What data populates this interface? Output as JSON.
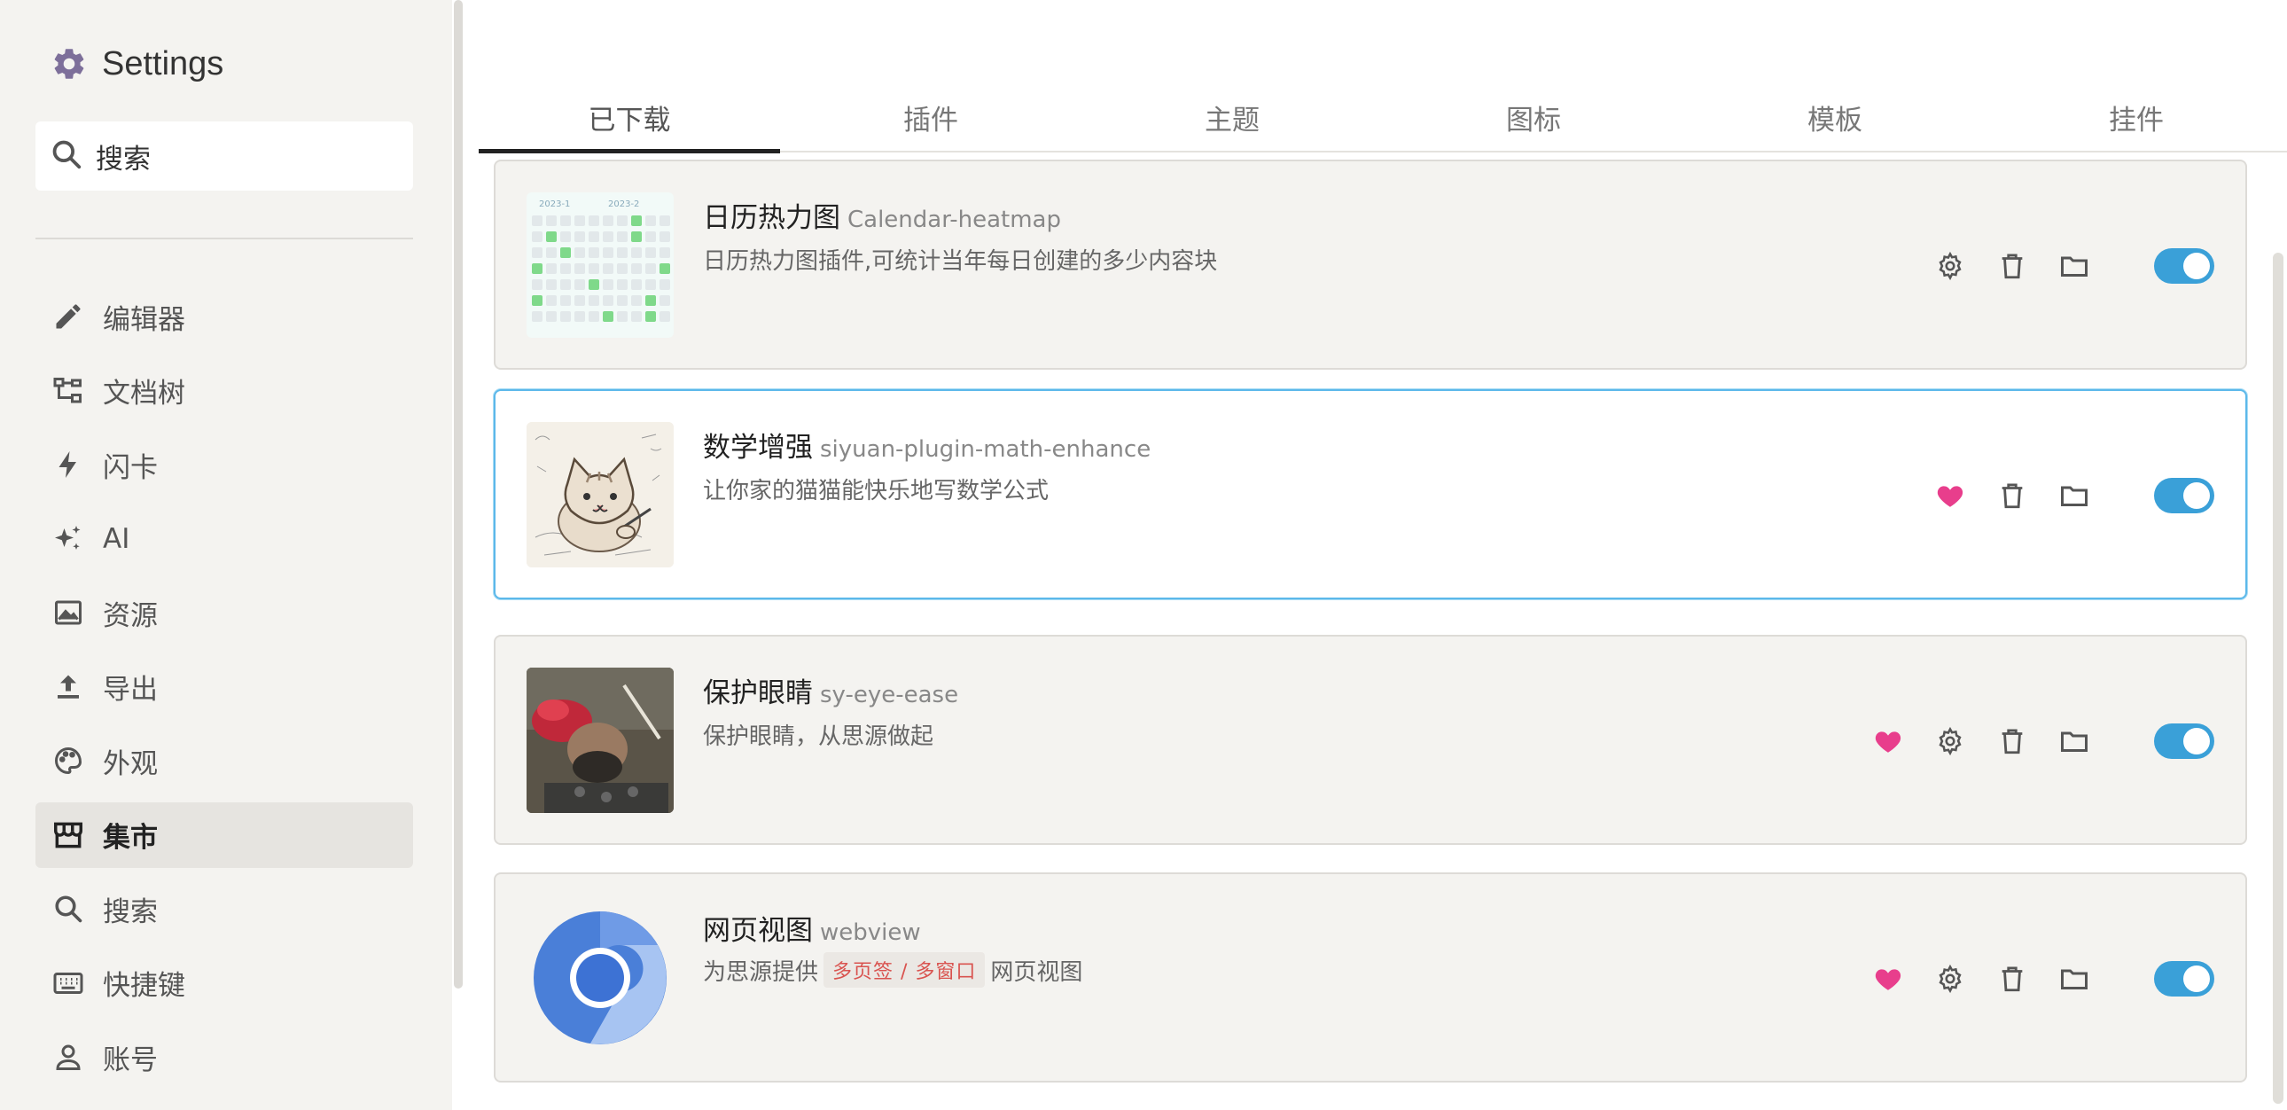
{
  "sidebar": {
    "title": "Settings",
    "search_placeholder": "搜索",
    "items": [
      {
        "label": "编辑器",
        "icon": "pencil-icon"
      },
      {
        "label": "文档树",
        "icon": "tree-icon"
      },
      {
        "label": "闪卡",
        "icon": "bolt-icon"
      },
      {
        "label": "AI",
        "icon": "sparkles-icon"
      },
      {
        "label": "资源",
        "icon": "image-icon"
      },
      {
        "label": "导出",
        "icon": "upload-icon"
      },
      {
        "label": "外观",
        "icon": "palette-icon"
      },
      {
        "label": "集市",
        "icon": "store-icon",
        "active": true
      },
      {
        "label": "搜索",
        "icon": "search-icon"
      },
      {
        "label": "快捷键",
        "icon": "keyboard-icon"
      },
      {
        "label": "账号",
        "icon": "user-icon"
      }
    ]
  },
  "tabs": [
    "已下载",
    "插件",
    "主题",
    "图标",
    "模板",
    "挂件"
  ],
  "active_tab": "已下载",
  "plugins": [
    {
      "name": "日历热力图",
      "pkg": "Calendar-heatmap",
      "desc": "日历热力图插件,可统计当年每日创建的多少内容块",
      "heart": false,
      "enabled": true,
      "thumb_labels": [
        "2023-1",
        "2023-2"
      ]
    },
    {
      "name": "数学增强",
      "pkg": "siyuan-plugin-math-enhance",
      "desc": "让你家的猫猫能快乐地写数学公式",
      "heart": true,
      "enabled": true,
      "settings": false
    },
    {
      "name": "保护眼睛",
      "pkg": "sy-eye-ease",
      "desc": "保护眼睛，从思源做起",
      "heart": true,
      "enabled": true
    },
    {
      "name": "网页视图",
      "pkg": "webview",
      "desc_prefix": "为思源提供",
      "tag": "多页签 / 多窗口",
      "desc_suffix": "网页视图",
      "heart": true,
      "enabled": true
    }
  ],
  "colors": {
    "accent": "#3aa0d8",
    "heart": "#e83e8c",
    "tag_text": "#d9534f"
  }
}
